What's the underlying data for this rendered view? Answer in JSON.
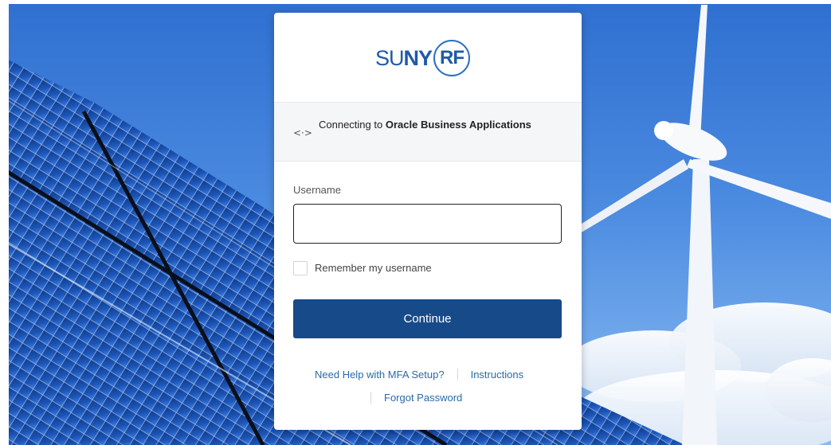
{
  "logo": {
    "text_light": "SU",
    "text_bold": "NY",
    "circle_text": "RF"
  },
  "connect": {
    "icon": "arrows-left-right-icon",
    "prefix": "Connecting to",
    "app_name": "Oracle Business Applications"
  },
  "form": {
    "username_label": "Username",
    "username_value": "",
    "username_placeholder": "",
    "remember_label": "Remember my username",
    "remember_checked": false,
    "continue_label": "Continue"
  },
  "links": {
    "mfa_help": "Need Help with MFA Setup?",
    "instructions": "Instructions",
    "forgot_password": "Forgot Password"
  },
  "colors": {
    "primary_button": "#174a89",
    "link": "#2a6aa8",
    "logo": "#1f5aa6"
  }
}
